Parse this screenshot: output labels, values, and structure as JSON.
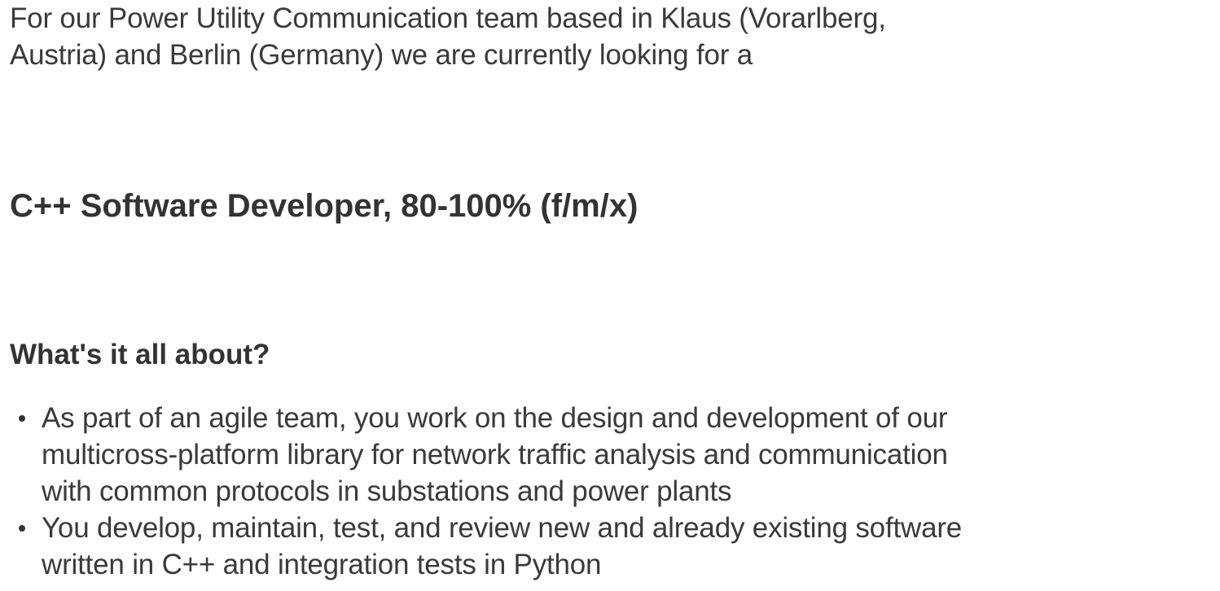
{
  "intro": {
    "line1": "For our Power Utility Communication team based in Klaus (Vorarlberg,",
    "line2": "Austria) and Berlin (Germany) we are currently looking for a"
  },
  "job_title": "C++ Software Developer, 80-100% (f/m/x)",
  "section": {
    "heading": "What's it all about?",
    "bullets": [
      {
        "line1": "As part of an agile team, you work on the design and development of our",
        "line2": "multicross-platform library for network traffic analysis and communication",
        "line3": "with common protocols in substations and power plants"
      },
      {
        "line1": "You develop, maintain, test, and review new and already existing software",
        "line2": "written in C++ and integration tests in Python"
      }
    ]
  }
}
